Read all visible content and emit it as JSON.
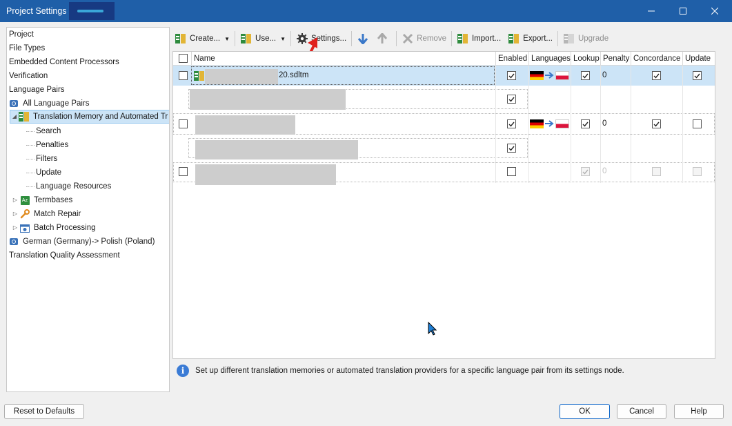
{
  "window": {
    "title": "Project Settings - ",
    "controls": [
      "minimize",
      "maximize",
      "close"
    ]
  },
  "tree": {
    "items": [
      {
        "label": "Project"
      },
      {
        "label": "File Types"
      },
      {
        "label": "Embedded Content Processors"
      },
      {
        "label": "Verification"
      },
      {
        "label": "Language Pairs"
      },
      {
        "label": "All Language Pairs",
        "icon": "language-pair-icon"
      },
      {
        "label": "Translation Memory and Automated Tr",
        "icon": "translation-memory-icon",
        "selected": true,
        "expanded": true
      },
      {
        "label": "Search"
      },
      {
        "label": "Penalties"
      },
      {
        "label": "Filters"
      },
      {
        "label": "Update"
      },
      {
        "label": "Language Resources"
      },
      {
        "label": "Termbases",
        "icon": "termbase-icon"
      },
      {
        "label": "Match Repair",
        "icon": "wrench-icon"
      },
      {
        "label": "Batch Processing",
        "icon": "batch-icon"
      },
      {
        "label": "German (Germany)-> Polish (Poland)",
        "icon": "language-pair-icon"
      },
      {
        "label": "Translation Quality Assessment"
      }
    ]
  },
  "toolbar": {
    "create": "Create...",
    "use": "Use...",
    "settings": "Settings...",
    "move_down": "move-down-arrow-icon",
    "move_up": "move-up-arrow-icon",
    "remove": "Remove",
    "import": "Import...",
    "export": "Export...",
    "upgrade": "Upgrade"
  },
  "grid": {
    "columns": [
      "Name",
      "Enabled",
      "Languages",
      "Lookup",
      "Penalty",
      "Concordance",
      "Update"
    ],
    "rows": [
      {
        "name": "20.sdltm",
        "enabled": true,
        "lookup": true,
        "penalty": "0",
        "concordance": true,
        "update": true,
        "selected": true
      },
      {
        "name": "",
        "enabled": true,
        "sub": true
      },
      {
        "name": "",
        "enabled": true,
        "lookup": true,
        "penalty": "0",
        "concordance": true,
        "update": false
      },
      {
        "name": "",
        "enabled": true,
        "sub": true
      },
      {
        "name": "",
        "enabled": false,
        "lookup": true,
        "penalty": "0",
        "concordance": false,
        "update": false,
        "disabled": true
      }
    ]
  },
  "info": {
    "text": "Set up different translation memories or automated translation providers for a specific language pair from its settings node."
  },
  "buttons": {
    "reset": "Reset to Defaults",
    "ok": "OK",
    "cancel": "Cancel",
    "help": "Help"
  },
  "colors": {
    "titlebar": "#1f5fa8",
    "selection": "#cce4f7",
    "annotation_arrow": "#e0201c"
  }
}
